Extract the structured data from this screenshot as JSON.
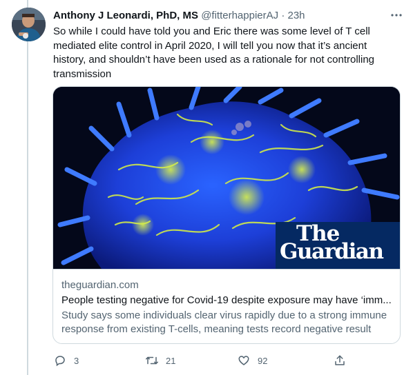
{
  "tweet": {
    "author_name": "Anthony J Leonardi, PhD, MS",
    "handle": "@fitterhappierAJ",
    "separator": "·",
    "time": "23h",
    "text": "So while I could have told you and Eric there was some level of T cell mediated elite control in April 2020, I will tell you now that it’s ancient history, and shouldn’t have been used as a rationale for not controlling transmission"
  },
  "card": {
    "logo_line1": "The",
    "logo_line2": "Guardian",
    "domain": "theguardian.com",
    "title": "People testing negative for Covid-19 despite exposure may have ‘imm...",
    "description": "Study says some individuals clear virus rapidly due to a strong immune response from existing T-cells, meaning tests record negative result"
  },
  "actions": {
    "reply_count": "3",
    "retweet_count": "21",
    "like_count": "92"
  },
  "icons": {
    "more": "more-dots-icon",
    "reply": "reply-icon",
    "retweet": "retweet-icon",
    "like": "heart-icon",
    "share": "share-icon"
  },
  "colors": {
    "text": "#0f1419",
    "secondary": "#536471",
    "border": "#cfd9de",
    "guardian_blue": "#052962"
  }
}
